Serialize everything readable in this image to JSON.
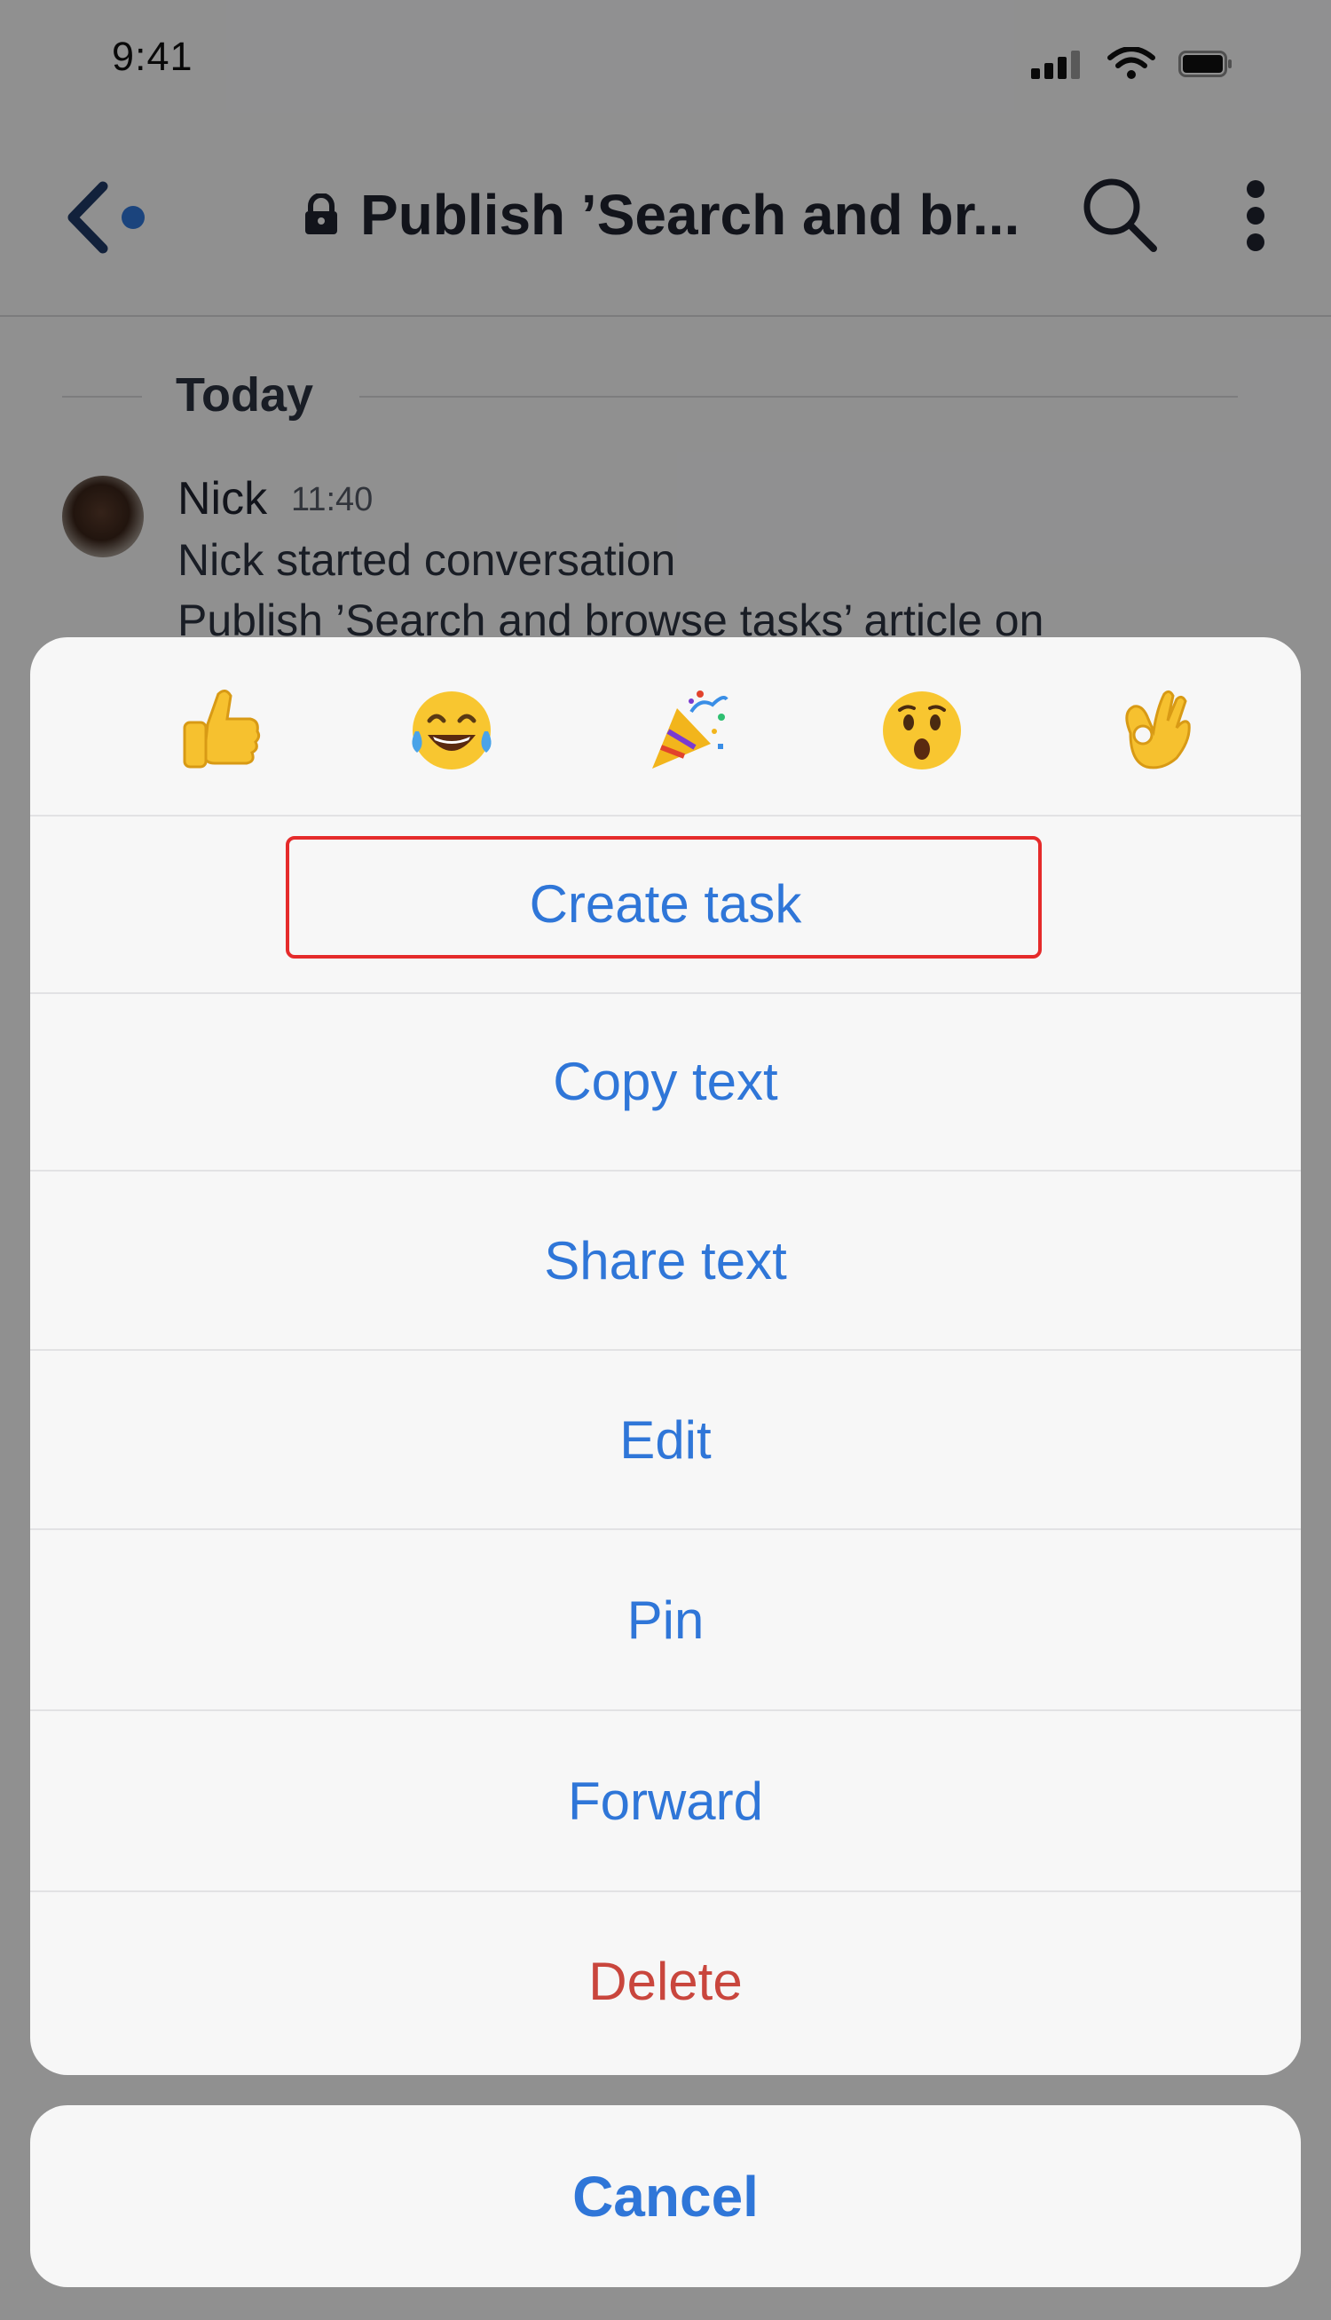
{
  "status_bar": {
    "time": "9:41"
  },
  "nav": {
    "title": "Publish ’Search and br..."
  },
  "chat": {
    "date_label": "Today",
    "message": {
      "sender": "Nick",
      "time": "11:40",
      "text": "Nick started conversation",
      "text_preview": "Publish ’Search and browse tasks’ article on"
    }
  },
  "reactions": [
    {
      "icon": "thumbs-up-emoji"
    },
    {
      "icon": "tears-of-joy-emoji"
    },
    {
      "icon": "party-popper-emoji"
    },
    {
      "icon": "hushed-face-emoji"
    },
    {
      "icon": "ok-hand-emoji"
    }
  ],
  "actions": {
    "create_task": "Create task",
    "copy_text": "Copy text",
    "share_text": "Share text",
    "edit": "Edit",
    "pin": "Pin",
    "forward": "Forward",
    "delete": "Delete"
  },
  "cancel_label": "Cancel",
  "colors": {
    "accent": "#2f76d8",
    "danger": "#c9463d",
    "highlight": "#e52b2b"
  }
}
